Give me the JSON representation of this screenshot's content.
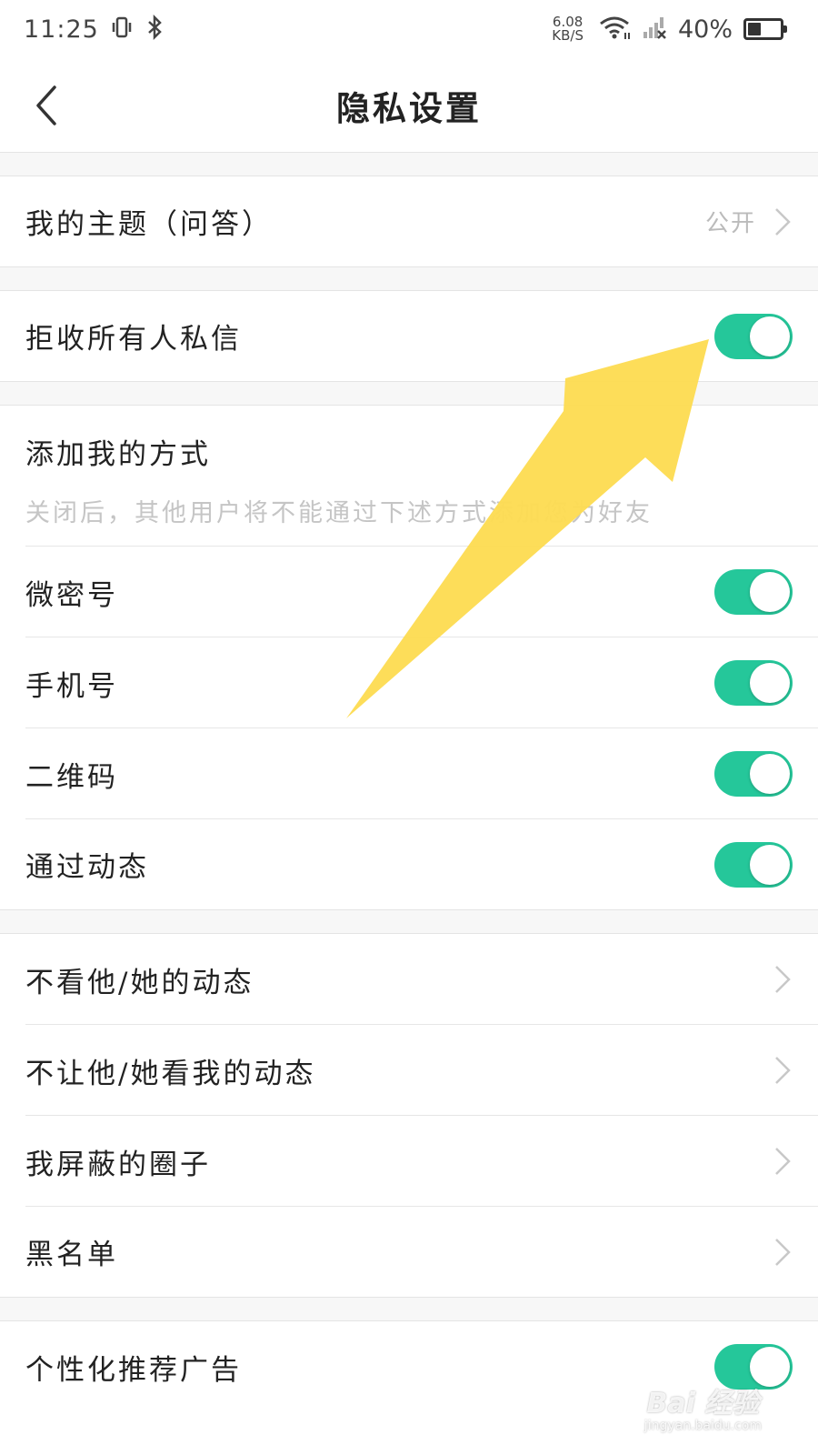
{
  "status_bar": {
    "time": "11:25",
    "net_speed_value": "6.08",
    "net_speed_unit": "KB/S",
    "battery_text": "40%",
    "battery_level": 0.4,
    "icons": [
      "vibrate-icon",
      "bluetooth-icon",
      "wifi-icon",
      "signal-icon"
    ]
  },
  "nav": {
    "title": "隐私设置",
    "back_icon": "chevron-left-icon"
  },
  "rows": {
    "my_topic": {
      "label": "我的主题（问答）",
      "value": "公开"
    },
    "reject_messages": {
      "label": "拒收所有人私信",
      "on": true
    }
  },
  "add_me": {
    "title": "添加我的方式",
    "description": "关闭后，其他用户将不能通过下述方式添加您为好友",
    "items": [
      {
        "label": "微密号",
        "on": true
      },
      {
        "label": "手机号",
        "on": true
      },
      {
        "label": "二维码",
        "on": true
      },
      {
        "label": "通过动态",
        "on": true
      }
    ]
  },
  "moments": {
    "items": [
      {
        "label": "不看他/她的动态"
      },
      {
        "label": "不让他/她看我的动态"
      },
      {
        "label": "我屏蔽的圈子"
      },
      {
        "label": "黑名单"
      }
    ]
  },
  "ads": {
    "label": "个性化推荐广告",
    "on": true
  },
  "colors": {
    "toggle_on": "#25c79a",
    "annotation_arrow": "#fddc52"
  },
  "watermark": {
    "main": "Bai 经验",
    "sub": "jingyan.baidu.com"
  }
}
